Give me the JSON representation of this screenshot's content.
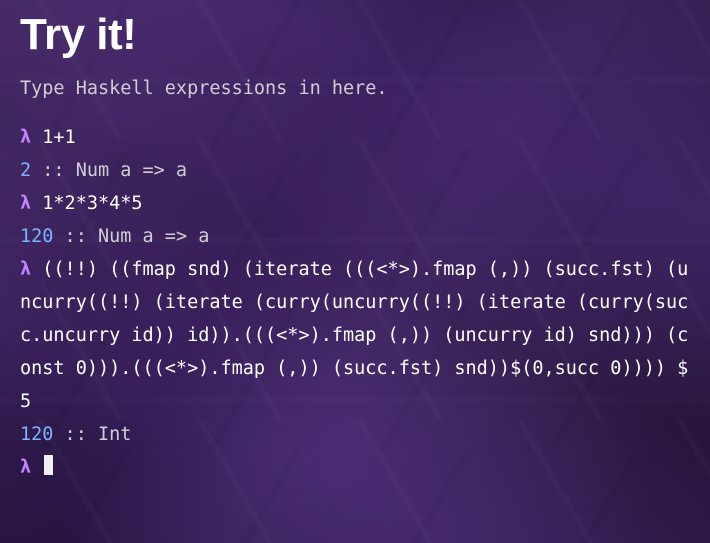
{
  "title": "Try it!",
  "intro": "Type Haskell expressions in here.",
  "prompt": "λ",
  "entries": [
    {
      "input": "1+1",
      "result_value": "2",
      "result_type": " :: Num a => a"
    },
    {
      "input": "1*2*3*4*5",
      "result_value": "120",
      "result_type": " :: Num a => a"
    },
    {
      "input": "((!!) ((fmap snd) (iterate (((<*>).fmap (,)) (succ.fst) (uncurry((!!) (iterate (curry(uncurry((!!) (iterate (curry(succ.uncurry id)) id)).(((<*>).fmap (,)) (uncurry id) snd))) (const 0))).(((<*>).fmap (,)) (succ.fst) snd))$(0,succ 0)))) $ 5",
      "result_value": "120",
      "result_type": " :: Int"
    }
  ]
}
